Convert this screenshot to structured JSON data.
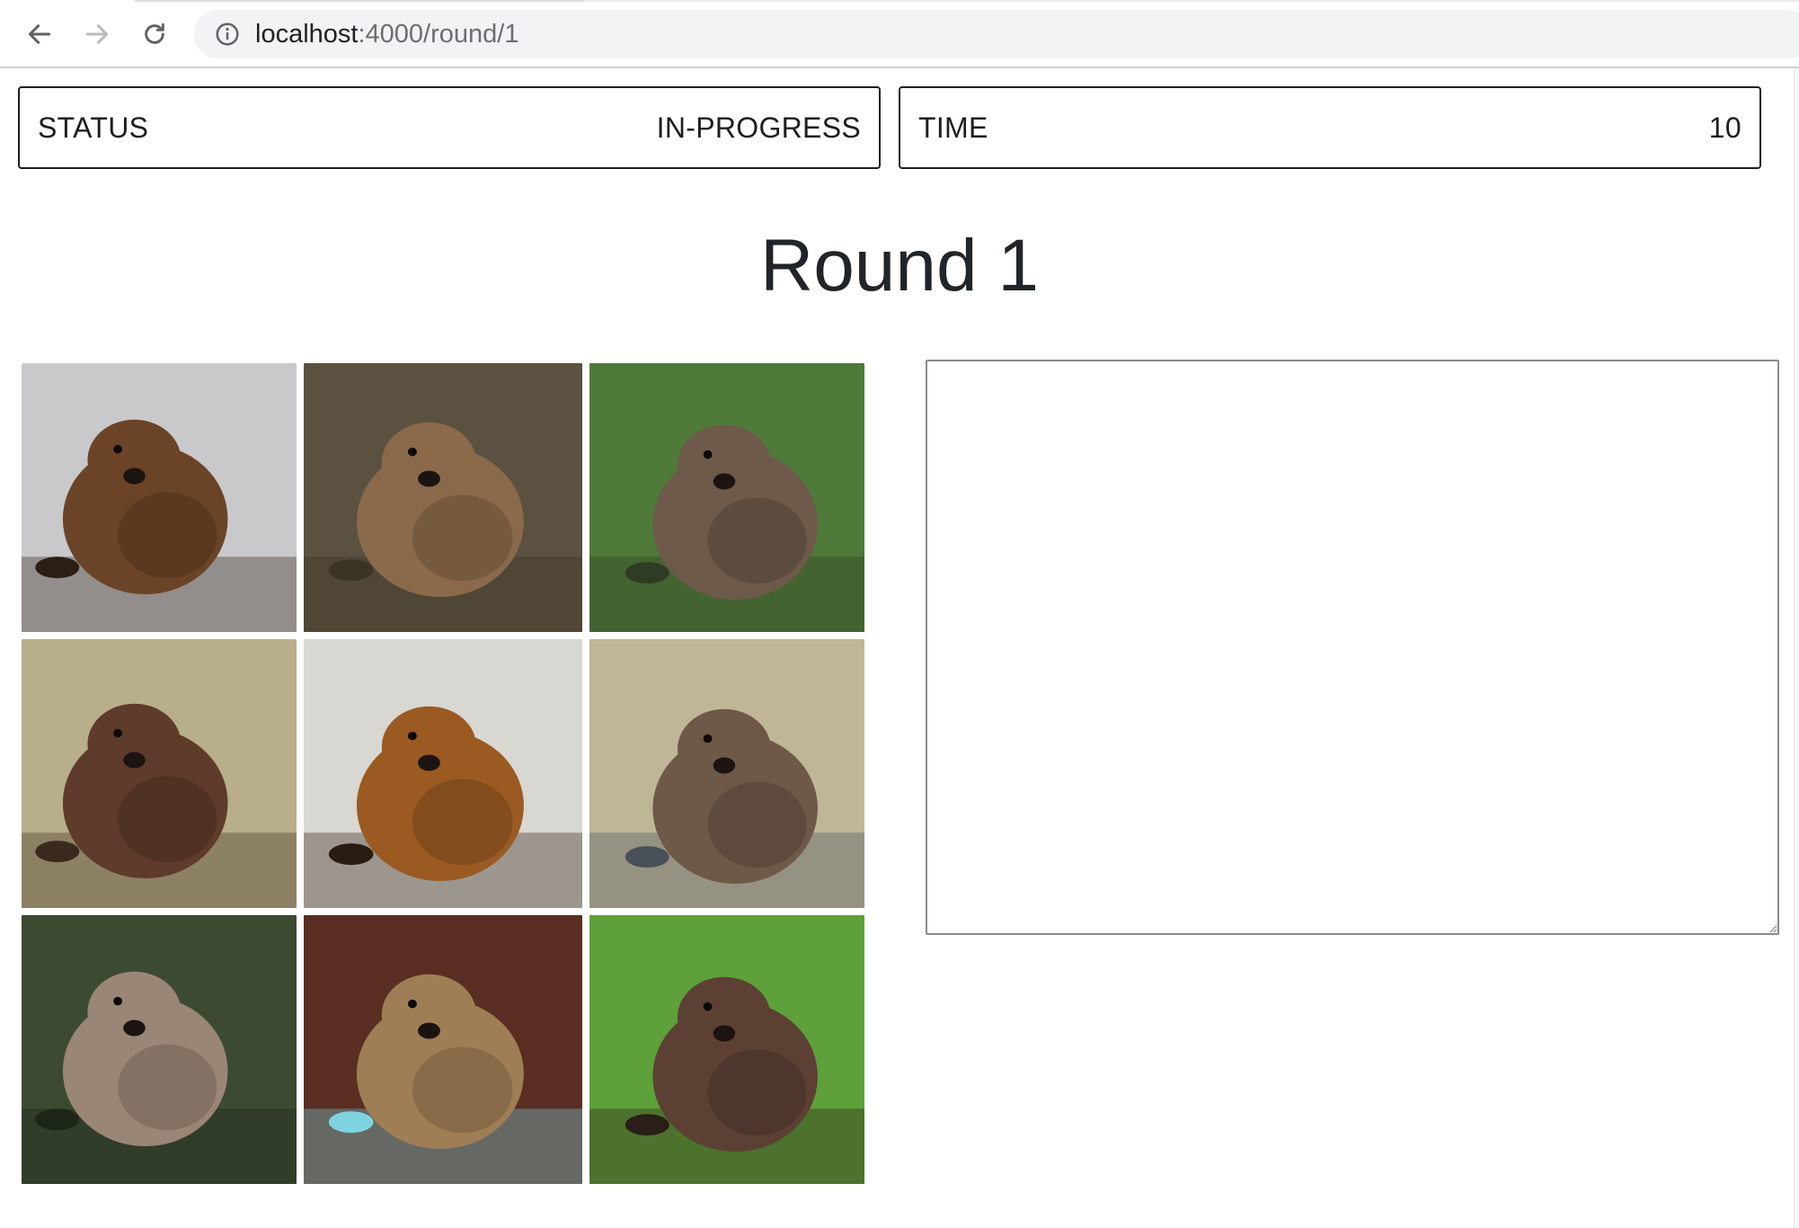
{
  "browser": {
    "url_host": "localhost",
    "url_path": ":4000/round/1"
  },
  "status": {
    "label": "STATUS",
    "value": "IN-PROGRESS"
  },
  "time": {
    "label": "TIME",
    "value": "10"
  },
  "title": "Round 1",
  "images": [
    {
      "subject": "beaver-photo",
      "bg": "#c9c9cb",
      "fur": "#6b4427",
      "accent": "#2d1e14"
    },
    {
      "subject": "beaver-photo",
      "bg": "#5a5140",
      "fur": "#8a6a4a",
      "accent": "#3b3324"
    },
    {
      "subject": "beaver-photo",
      "bg": "#4f7a3a",
      "fur": "#6d5a4a",
      "accent": "#2f3b22"
    },
    {
      "subject": "beaver-photo",
      "bg": "#b9ae8c",
      "fur": "#5e3b2a",
      "accent": "#3a2a1e"
    },
    {
      "subject": "beaver-photo",
      "bg": "#d9d7d2",
      "fur": "#9a5a22",
      "accent": "#2a1c12"
    },
    {
      "subject": "beaver-photo",
      "bg": "#bfb698",
      "fur": "#6e5848",
      "accent": "#4a5058"
    },
    {
      "subject": "beaver-photo",
      "bg": "#3d4a32",
      "fur": "#9a8676",
      "accent": "#1d2418"
    },
    {
      "subject": "beaver-photo",
      "bg": "#5a2e22",
      "fur": "#a07e55",
      "accent": "#7fd3e0"
    },
    {
      "subject": "beaver-photo",
      "bg": "#5ea03a",
      "fur": "#5c4034",
      "accent": "#2a1e18"
    }
  ],
  "answer": {
    "value": "",
    "placeholder": ""
  },
  "colors": {
    "card_border": "#1f1f1f",
    "title": "#212529",
    "textarea_border": "#8a8a8a"
  }
}
